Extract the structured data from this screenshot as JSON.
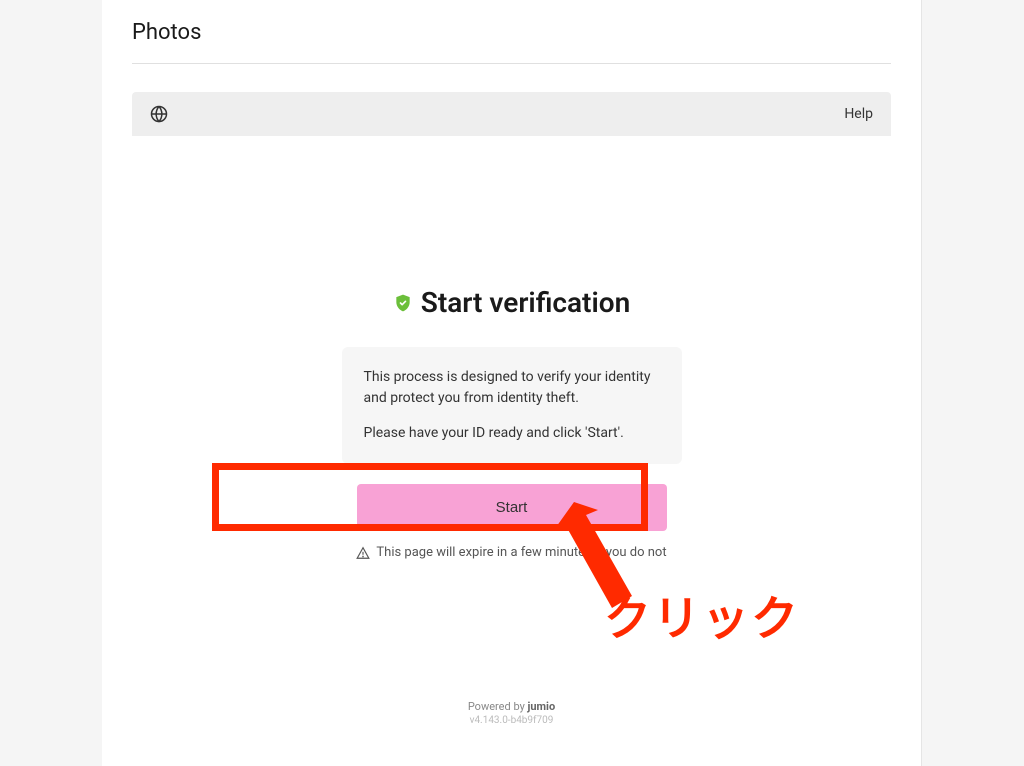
{
  "section": {
    "title": "Photos"
  },
  "frame": {
    "help_label": "Help"
  },
  "verification": {
    "title": "Start verification",
    "info_line1": "This process is designed to verify your identity and protect you from identity theft.",
    "info_line2": "Please have your ID ready and click 'Start'.",
    "start_button": "Start",
    "expire_text": "This page will expire in a few minutes if you do not"
  },
  "footer": {
    "powered_prefix": "Powered by ",
    "powered_brand": "jumio",
    "version": "v4.143.0-b4b9f709"
  },
  "annotation": {
    "click_text": "クリック"
  }
}
